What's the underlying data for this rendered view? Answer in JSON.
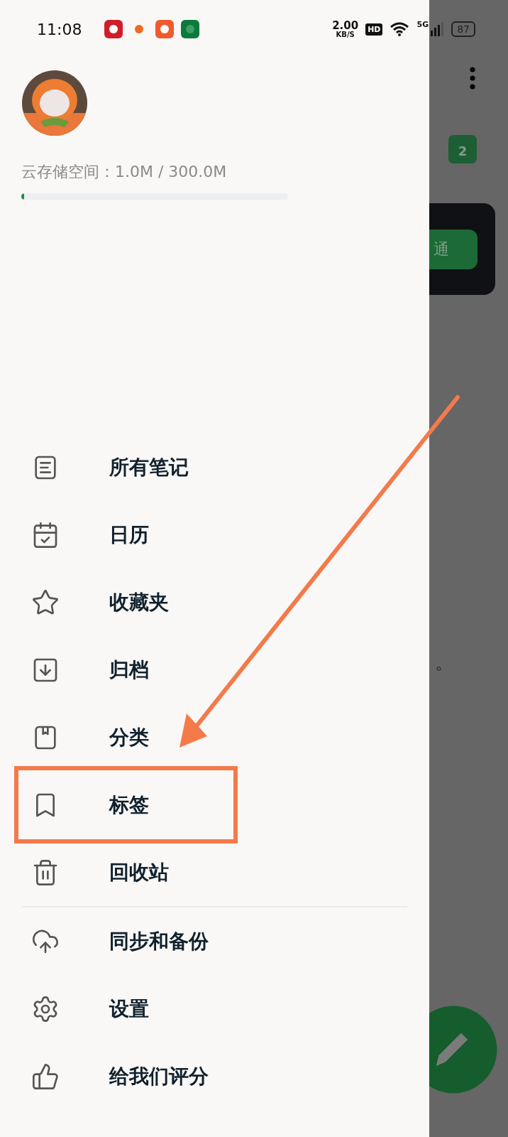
{
  "status_bar": {
    "time": "11:08",
    "net_speed": "2.00",
    "net_unit": "KB/S",
    "hd": "HD",
    "network": "5G",
    "battery": "87"
  },
  "drawer": {
    "storage_label": "云存储空间：1.0M / 300.0M",
    "storage": {
      "level": 0.01
    },
    "menu_groups": [
      [
        {
          "label": "所有笔记",
          "highlighted": false
        },
        {
          "label": "日历",
          "highlighted": false
        },
        {
          "label": "收藏夹",
          "highlighted": false
        },
        {
          "label": "归档",
          "highlighted": false
        },
        {
          "label": "分类",
          "highlighted": false
        },
        {
          "label": "标签",
          "highlighted": true
        },
        {
          "label": "回收站",
          "highlighted": false
        }
      ],
      [
        {
          "label": "同步和备份",
          "highlighted": false
        },
        {
          "label": "设置",
          "highlighted": false
        },
        {
          "label": "给我们评分",
          "highlighted": false
        }
      ]
    ]
  },
  "background_app": {
    "calendar_day": "2",
    "card_button": "通",
    "text_fragment": "。"
  }
}
